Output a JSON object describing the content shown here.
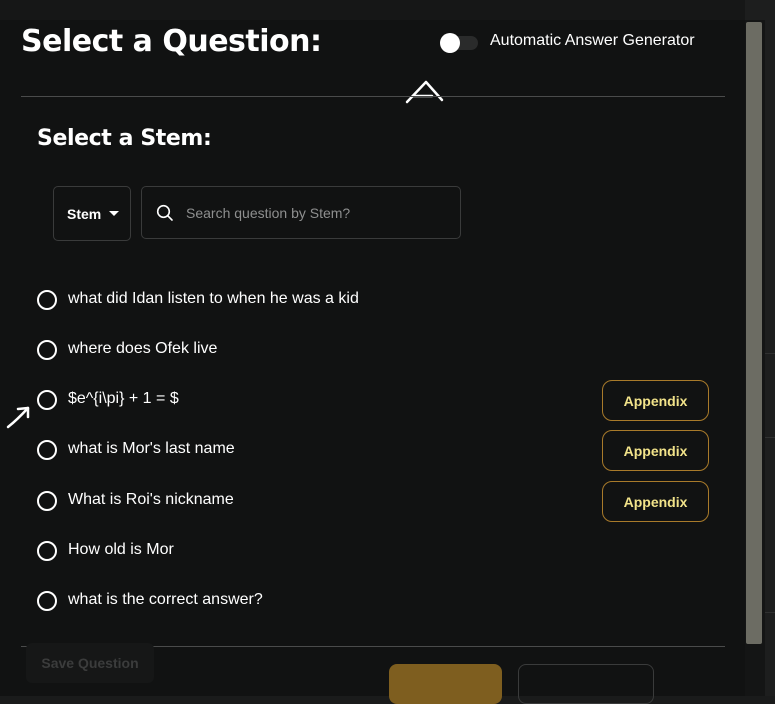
{
  "header": {
    "title": "Select a Question:",
    "toggle_label": "Automatic Answer Generator",
    "toggle_on": false
  },
  "stem_section": {
    "title": "Select a Stem:",
    "dropdown_value": "Stem",
    "search_placeholder": "Search question by Stem?"
  },
  "questions": [
    {
      "text": "what did Idan listen to when he was a kid",
      "has_appendix": false
    },
    {
      "text": "where does Ofek live",
      "has_appendix": false
    },
    {
      "text": "$e^{i\\pi} + 1 = $",
      "has_appendix": true
    },
    {
      "text": "what is Mor's last name",
      "has_appendix": true
    },
    {
      "text": "What is Roi's nickname",
      "has_appendix": true
    },
    {
      "text": "How old is Mor",
      "has_appendix": false
    },
    {
      "text": "what is the correct answer?",
      "has_appendix": false
    }
  ],
  "appendix_label": "Appendix",
  "footer": {
    "save_label": "Save Question"
  },
  "icons": {
    "search": "search-icon",
    "caret": "chevron-down-icon",
    "annotation": "hand-drawn-arrow-icon"
  },
  "colors": {
    "background": "#111212",
    "appendix_border": "#a87a2a",
    "appendix_text": "#f2e38a",
    "gold_button": "#7e5e1f"
  }
}
